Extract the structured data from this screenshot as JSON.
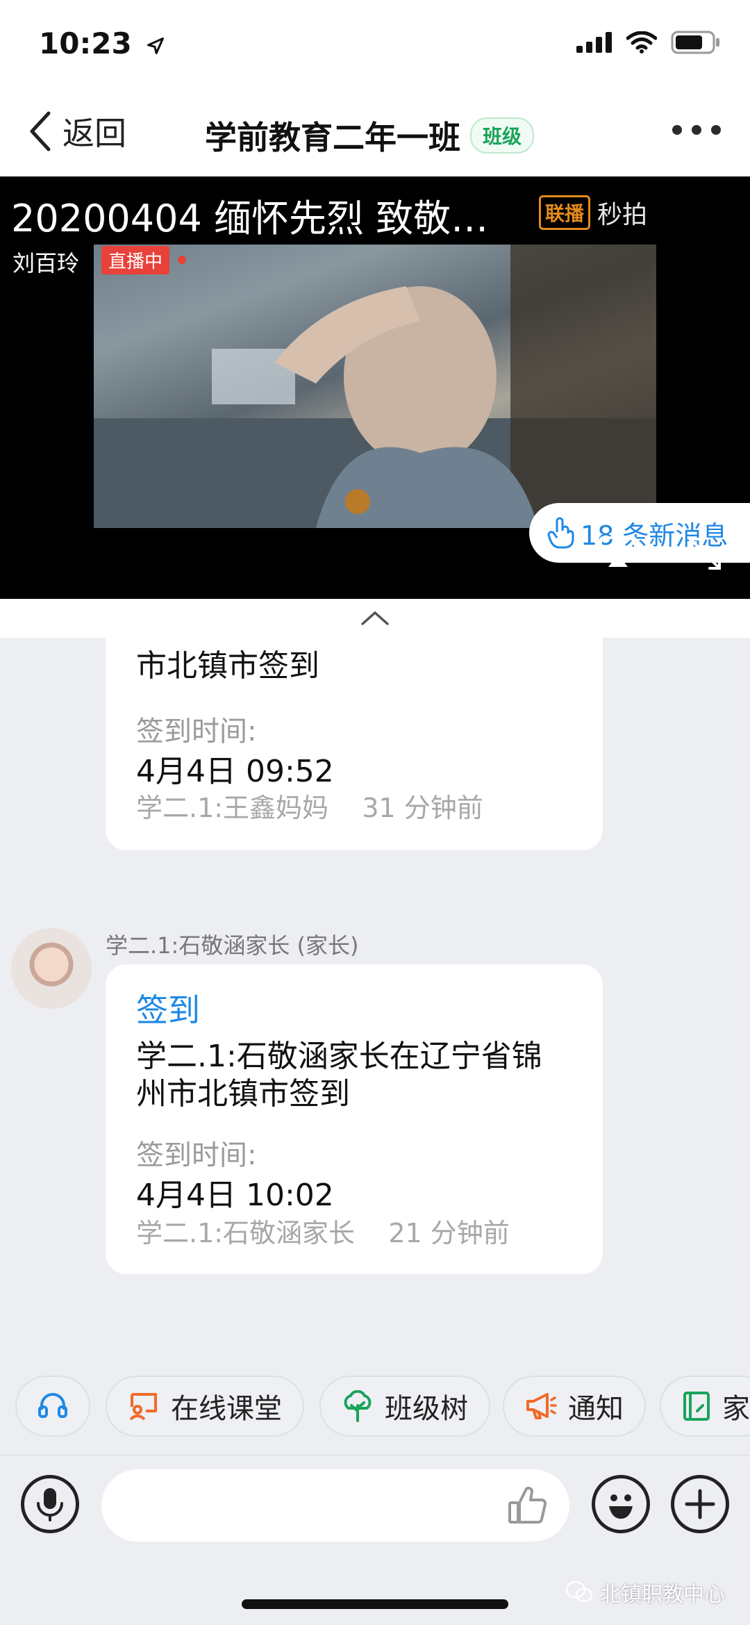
{
  "status_bar": {
    "time": "10:23"
  },
  "nav": {
    "back_label": "返回",
    "title": "学前教育二年一班",
    "badge": "班级"
  },
  "video": {
    "title": "20200404 缅怀先烈 致敬…",
    "host": "刘百玲",
    "live_label": "直播中",
    "watermark_box": "联播",
    "watermark_text": "秒拍",
    "new_messages": "18 条新消息"
  },
  "messages": [
    {
      "partial_text": "市北镇市签到",
      "time_label": "签到时间:",
      "time_value": "4月4日 09:52",
      "footer": "学二.1:王鑫妈妈    31 分钟前"
    },
    {
      "sender": "学二.1:石敬涵家长 (家长)",
      "action": "签到",
      "text_line1": "学二.1:石敬涵家长在辽宁省锦",
      "text_line2": "州市北镇市签到",
      "time_label": "签到时间:",
      "time_value": "4月4日 10:02",
      "footer": "学二.1:石敬涵家长    21 分钟前"
    }
  ],
  "quick_actions": [
    {
      "label": "",
      "icon": "headset-icon",
      "color": "#1e88e5"
    },
    {
      "label": "在线课堂",
      "icon": "online-class-icon",
      "color": "#f06a2a"
    },
    {
      "label": "班级树",
      "icon": "class-tree-icon",
      "color": "#1aa35a"
    },
    {
      "label": "通知",
      "icon": "megaphone-icon",
      "color": "#f06a2a"
    },
    {
      "label": "家",
      "icon": "notebook-icon",
      "color": "#1aa35a"
    }
  ],
  "footer_watermark": "北镇职教中心"
}
